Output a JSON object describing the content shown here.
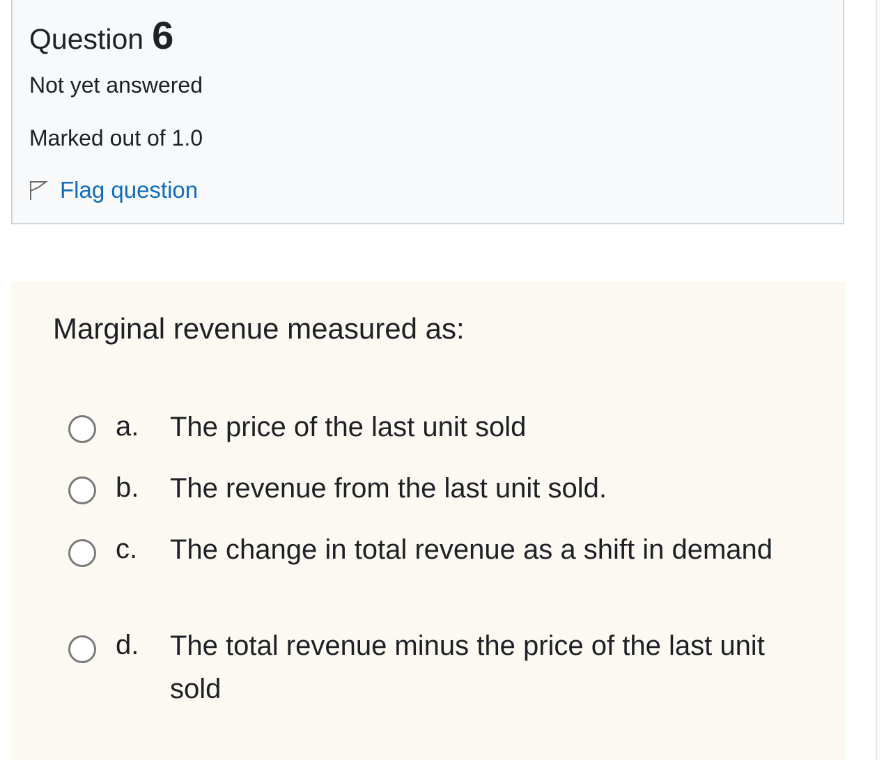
{
  "question": {
    "title_word": "Question",
    "number": "6",
    "state": "Not yet answered",
    "grade": "Marked out of 1.0",
    "flag_label": "Flag question",
    "flag_icon": "flag-outline-icon",
    "text": "Marginal revenue measured as:"
  },
  "answers": [
    {
      "letter": "a.",
      "text": "The price of the last unit sold",
      "selected": false
    },
    {
      "letter": "b.",
      "text": "The revenue from the last unit sold.",
      "selected": false
    },
    {
      "letter": "c.",
      "text": "The change in total revenue as a shift in demand",
      "selected": false
    },
    {
      "letter": "d.",
      "text": "The total revenue minus the price of the last unit sold",
      "selected": false
    }
  ],
  "colors": {
    "link": "#0f6cbf",
    "info_background": "#f8f9fa",
    "info_border": "#cfd4da",
    "content_background": "#fcf8f2",
    "radio_border": "#7a7a7a"
  }
}
